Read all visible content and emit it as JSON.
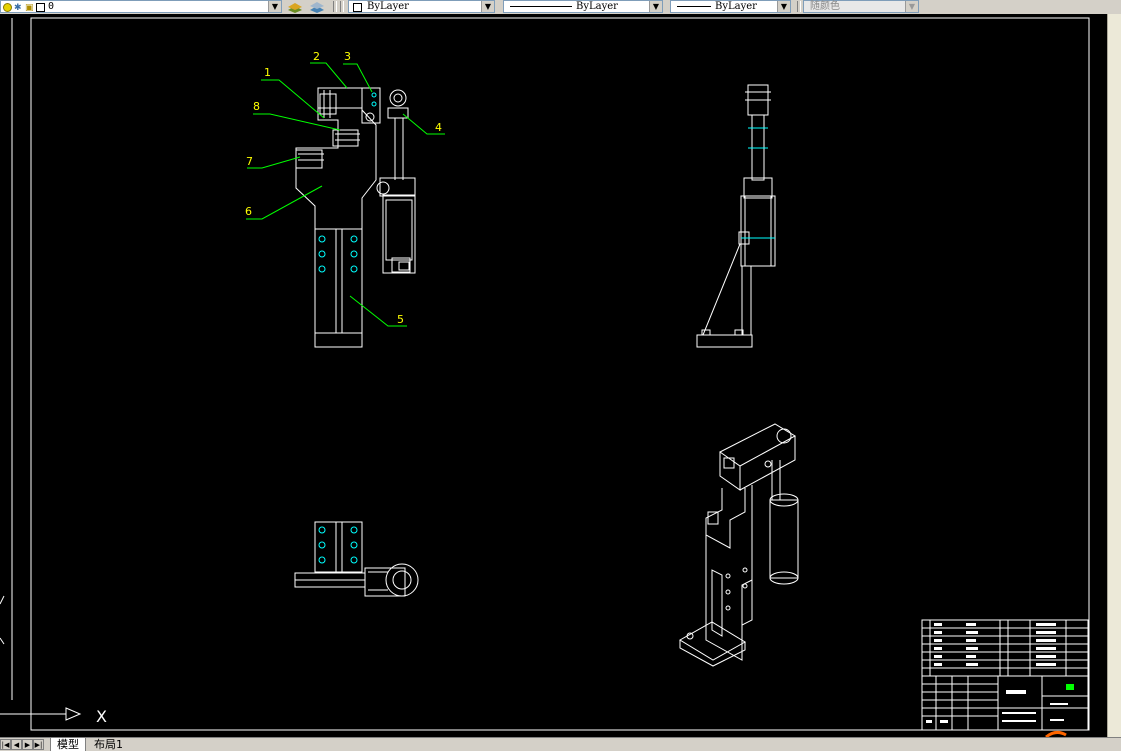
{
  "toolbar": {
    "layer_name": "0",
    "color_control": "ByLayer",
    "linetype_control": "ByLayer",
    "lineweight_control": "ByLayer",
    "plotstyle_control": "随颜色"
  },
  "drawing": {
    "balloons": [
      "1",
      "2",
      "3",
      "4",
      "5",
      "6",
      "7",
      "8"
    ]
  },
  "ucs": {
    "x_label": "X"
  },
  "tabs": {
    "model": "模型",
    "layout1": "布局1"
  },
  "colors": {
    "model_space_bg": "#000000",
    "geometry": "#ffffff",
    "leader": "#00ff00",
    "balloon_text": "#ffff00",
    "hidden_detail": "#00ffff",
    "toolbar_bg": "#d4d0c8"
  }
}
